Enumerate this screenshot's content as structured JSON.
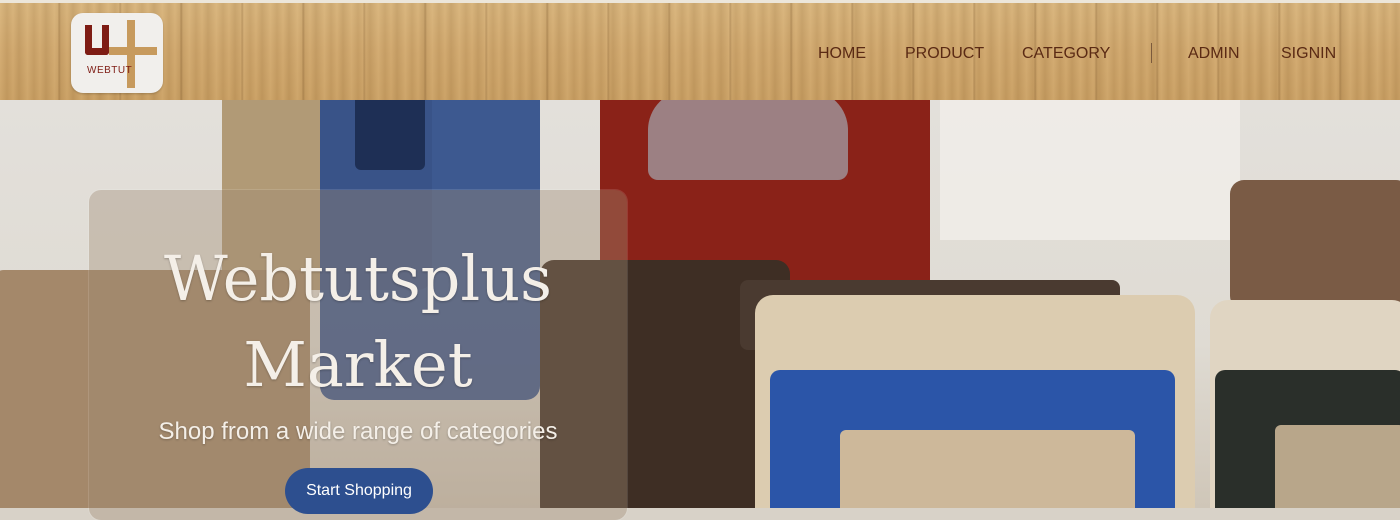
{
  "brand": {
    "logo_text": "WEBTUT"
  },
  "nav": {
    "home": "HOME",
    "product": "PRODUCT",
    "category": "CATEGORY",
    "separator": "|",
    "admin": "ADMIN",
    "signin": "SIGNIN"
  },
  "hero": {
    "title": "Webtutsplus Market",
    "subtitle": "Shop from a wide range of categories",
    "cta_label": "Start Shopping"
  },
  "colors": {
    "header_wood": "#cfa66c",
    "nav_text": "#5a2a14",
    "logo_accent_dark": "#7e1c14",
    "logo_accent_light": "#c79a5d",
    "cta_bg": "#2d4f8f"
  }
}
